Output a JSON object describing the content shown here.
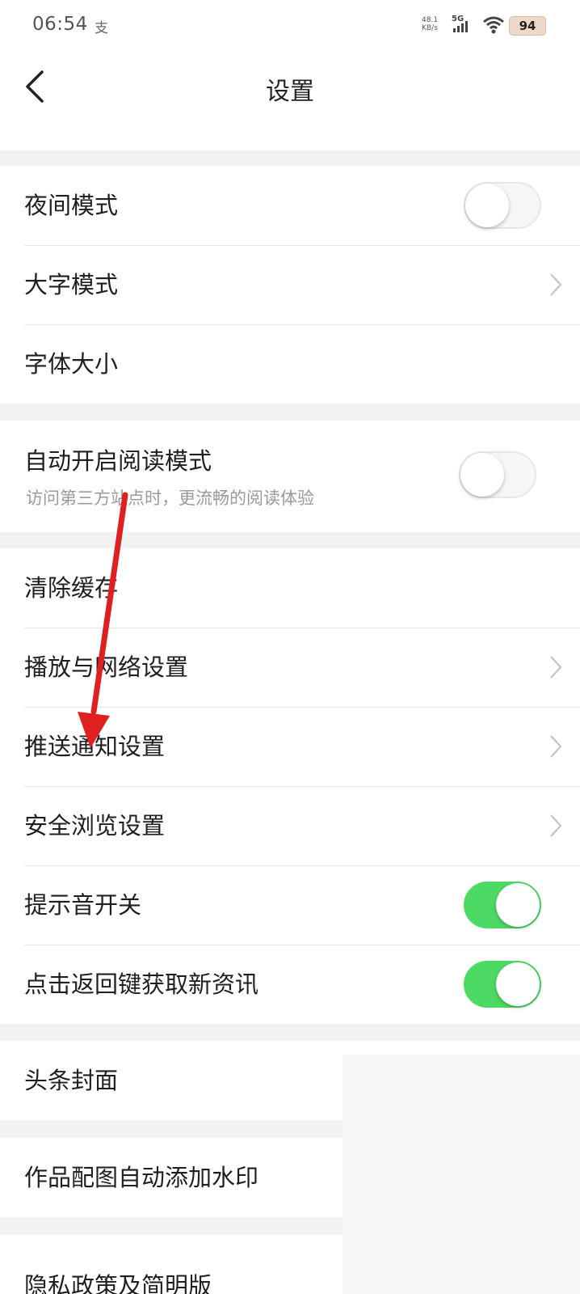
{
  "status_bar": {
    "time": "06:54",
    "app_icon_glyph": "支",
    "network_speed_value": "48.1",
    "network_speed_unit": "KB/s",
    "signal_label": "5G",
    "battery": "94"
  },
  "nav": {
    "title": "设置"
  },
  "sections": {
    "display": {
      "night_mode": {
        "label": "夜间模式",
        "toggle_on": false
      },
      "large_text_mode": {
        "label": "大字模式"
      },
      "font_size": {
        "label": "字体大小"
      }
    },
    "reading": {
      "auto_reading_mode": {
        "label": "自动开启阅读模式",
        "description": "访问第三方站点时，更流畅的阅读体验",
        "toggle_on": false
      }
    },
    "general": {
      "clear_cache": {
        "label": "清除缓存"
      },
      "playback_network": {
        "label": "播放与网络设置"
      },
      "push_notifications": {
        "label": "推送通知设置"
      },
      "safe_browsing": {
        "label": "安全浏览设置"
      },
      "sound_toggle": {
        "label": "提示音开关",
        "toggle_on": true
      },
      "back_key_refresh": {
        "label": "点击返回键获取新资讯",
        "toggle_on": true
      }
    },
    "cover": {
      "headline_cover": {
        "label": "头条封面"
      }
    },
    "watermark": {
      "auto_watermark": {
        "label": "作品配图自动添加水印"
      }
    },
    "privacy": {
      "privacy_policy": {
        "label": "隐私政策及简明版"
      }
    }
  },
  "colors": {
    "toggle_on": "#4cd964",
    "annotation_arrow": "#e02020"
  },
  "icons": [
    "back-arrow-icon",
    "chevron-right-icon",
    "wifi-icon",
    "signal-icon",
    "battery-icon"
  ]
}
